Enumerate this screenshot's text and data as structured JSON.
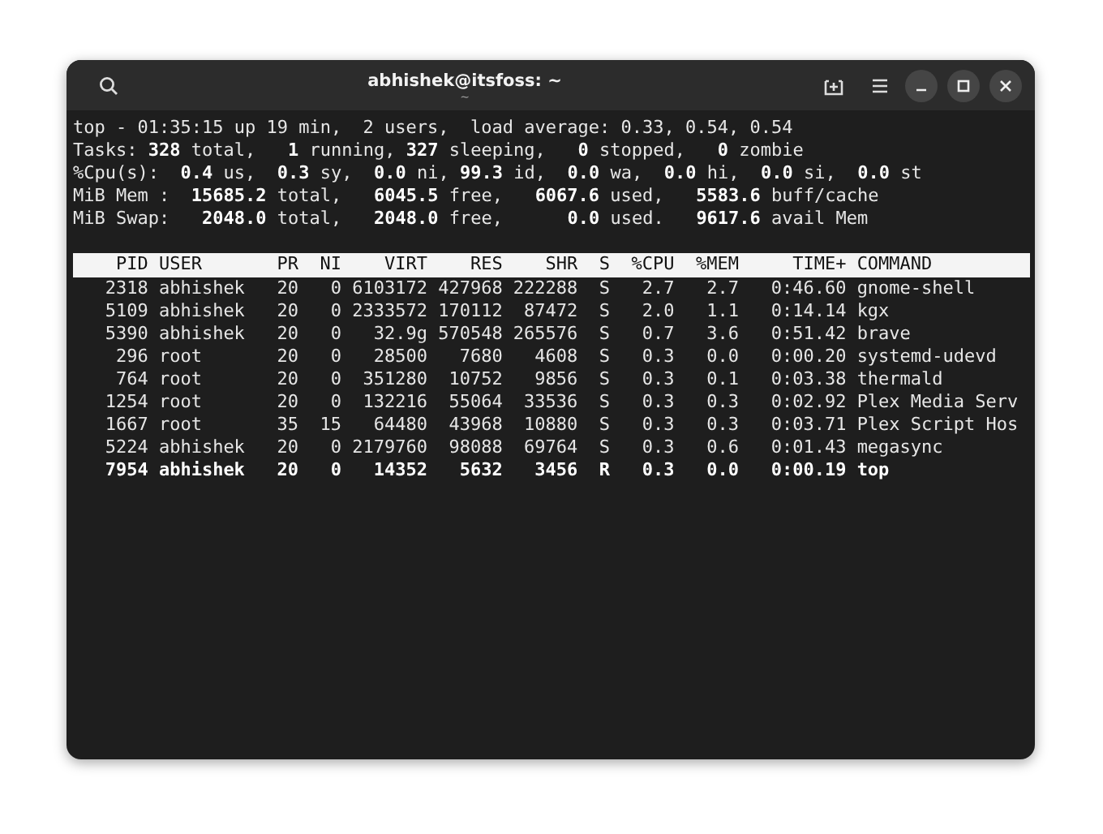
{
  "window": {
    "title": "abhishek@itsfoss: ~",
    "subtitle": "~"
  },
  "summary": [
    "top - 01:35:15 up 19 min,  2 users,  load average: 0.33, 0.54, 0.54",
    "Tasks: **328** total,   **1** running, **327** sleeping,   **0** stopped,   **0** zombie",
    "%Cpu(s):  **0.4** us,  **0.3** sy,  **0.0** ni, **99.3** id,  **0.0** wa,  **0.0** hi,  **0.0** si,  **0.0** st",
    "MiB Mem :  **15685.2** total,   **6045.5** free,   **6067.6** used,   **5583.6** buff/cache",
    "MiB Swap:   **2048.0** total,   **2048.0** free,      **0.0** used.   **9617.6** avail Mem"
  ],
  "table": {
    "columns": [
      "PID",
      "USER",
      "PR",
      "NI",
      "VIRT",
      "RES",
      "SHR",
      "S",
      "%CPU",
      "%MEM",
      "TIME+",
      "COMMAND"
    ],
    "rows": [
      {
        "running": false,
        "cells": [
          "2318",
          "abhishek",
          "20",
          "0",
          "6103172",
          "427968",
          "222288",
          "S",
          "2.7",
          "2.7",
          "0:46.60",
          "gnome-shell"
        ]
      },
      {
        "running": false,
        "cells": [
          "5109",
          "abhishek",
          "20",
          "0",
          "2333572",
          "170112",
          "87472",
          "S",
          "2.0",
          "1.1",
          "0:14.14",
          "kgx"
        ]
      },
      {
        "running": false,
        "cells": [
          "5390",
          "abhishek",
          "20",
          "0",
          "32.9g",
          "570548",
          "265576",
          "S",
          "0.7",
          "3.6",
          "0:51.42",
          "brave"
        ]
      },
      {
        "running": false,
        "cells": [
          "296",
          "root",
          "20",
          "0",
          "28500",
          "7680",
          "4608",
          "S",
          "0.3",
          "0.0",
          "0:00.20",
          "systemd-udevd"
        ]
      },
      {
        "running": false,
        "cells": [
          "764",
          "root",
          "20",
          "0",
          "351280",
          "10752",
          "9856",
          "S",
          "0.3",
          "0.1",
          "0:03.38",
          "thermald"
        ]
      },
      {
        "running": false,
        "cells": [
          "1254",
          "root",
          "20",
          "0",
          "132216",
          "55064",
          "33536",
          "S",
          "0.3",
          "0.3",
          "0:02.92",
          "Plex Media Serv"
        ]
      },
      {
        "running": false,
        "cells": [
          "1667",
          "root",
          "35",
          "15",
          "64480",
          "43968",
          "10880",
          "S",
          "0.3",
          "0.3",
          "0:03.71",
          "Plex Script Hos"
        ]
      },
      {
        "running": false,
        "cells": [
          "5224",
          "abhishek",
          "20",
          "0",
          "2179760",
          "98088",
          "69764",
          "S",
          "0.3",
          "0.6",
          "0:01.43",
          "megasync"
        ]
      },
      {
        "running": true,
        "cells": [
          "7954",
          "abhishek",
          "20",
          "0",
          "14352",
          "5632",
          "3456",
          "R",
          "0.3",
          "0.0",
          "0:00.19",
          "top"
        ]
      }
    ]
  }
}
